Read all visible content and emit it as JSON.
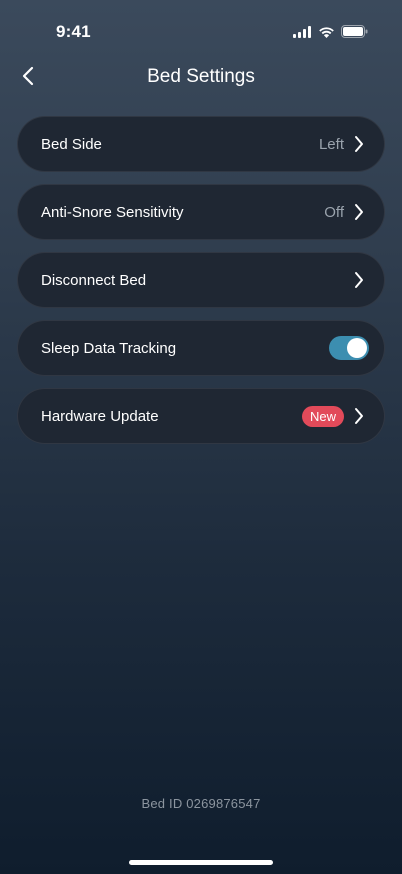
{
  "status_bar": {
    "time": "9:41"
  },
  "nav": {
    "title": "Bed Settings"
  },
  "settings": [
    {
      "label": "Bed Side",
      "value": "Left"
    },
    {
      "label": "Anti-Snore Sensitivity",
      "value": "Off"
    },
    {
      "label": "Disconnect Bed"
    },
    {
      "label": "Sleep Data Tracking",
      "toggle_on": true
    },
    {
      "label": "Hardware Update",
      "badge": "New"
    }
  ],
  "footer": {
    "bed_id": "Bed ID 0269876547"
  },
  "colors": {
    "toggle_on": "#3c8eb0",
    "badge": "#e24a5a"
  }
}
